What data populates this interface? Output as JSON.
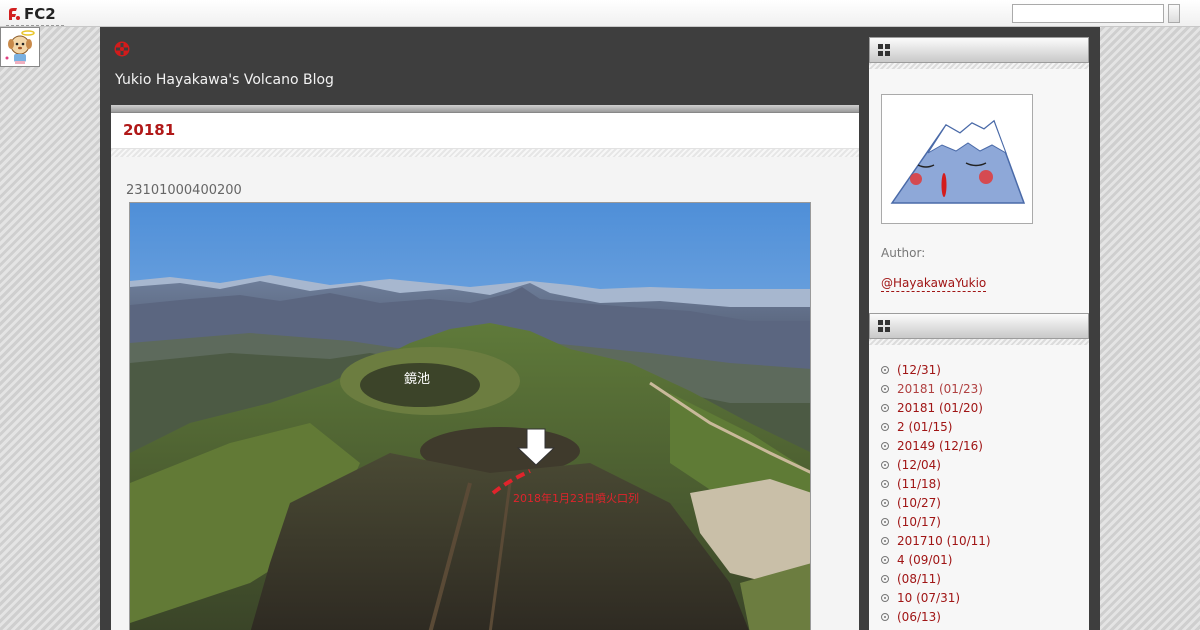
{
  "fc2": {
    "logo_text": "FC2"
  },
  "blog": {
    "title": "Yukio Hayakawa's Volcano Blog"
  },
  "entry": {
    "title": "20181",
    "date_text": "23101000400200",
    "photo_labels": {
      "pond": "鏡池",
      "vent": "2018年1月23日噴火口列"
    }
  },
  "sidebar": {
    "author_label": "Author:",
    "author_link": "@HayakawaYukio",
    "archive": [
      {
        "label": " (12/31)"
      },
      {
        "label": "20181 (01/23)"
      },
      {
        "label": "20181 (01/20)"
      },
      {
        "label": "2 (01/15)"
      },
      {
        "label": "20149 (12/16)"
      },
      {
        "label": " (12/04)"
      },
      {
        "label": " (11/18)"
      },
      {
        "label": " (10/27)"
      },
      {
        "label": " (10/17)"
      },
      {
        "label": "201710 (10/11)"
      },
      {
        "label": "4 (09/01)"
      },
      {
        "label": " (08/11)"
      },
      {
        "label": "10 (07/31)"
      },
      {
        "label": " (06/13)"
      }
    ]
  },
  "colors": {
    "accent": "#b01818",
    "header_bg": "#3e3e3e",
    "link": "#a01515"
  },
  "icons": [
    "fc2-logo-icon",
    "mascot-icon",
    "header-icon",
    "box-icon",
    "bullet-icon"
  ]
}
